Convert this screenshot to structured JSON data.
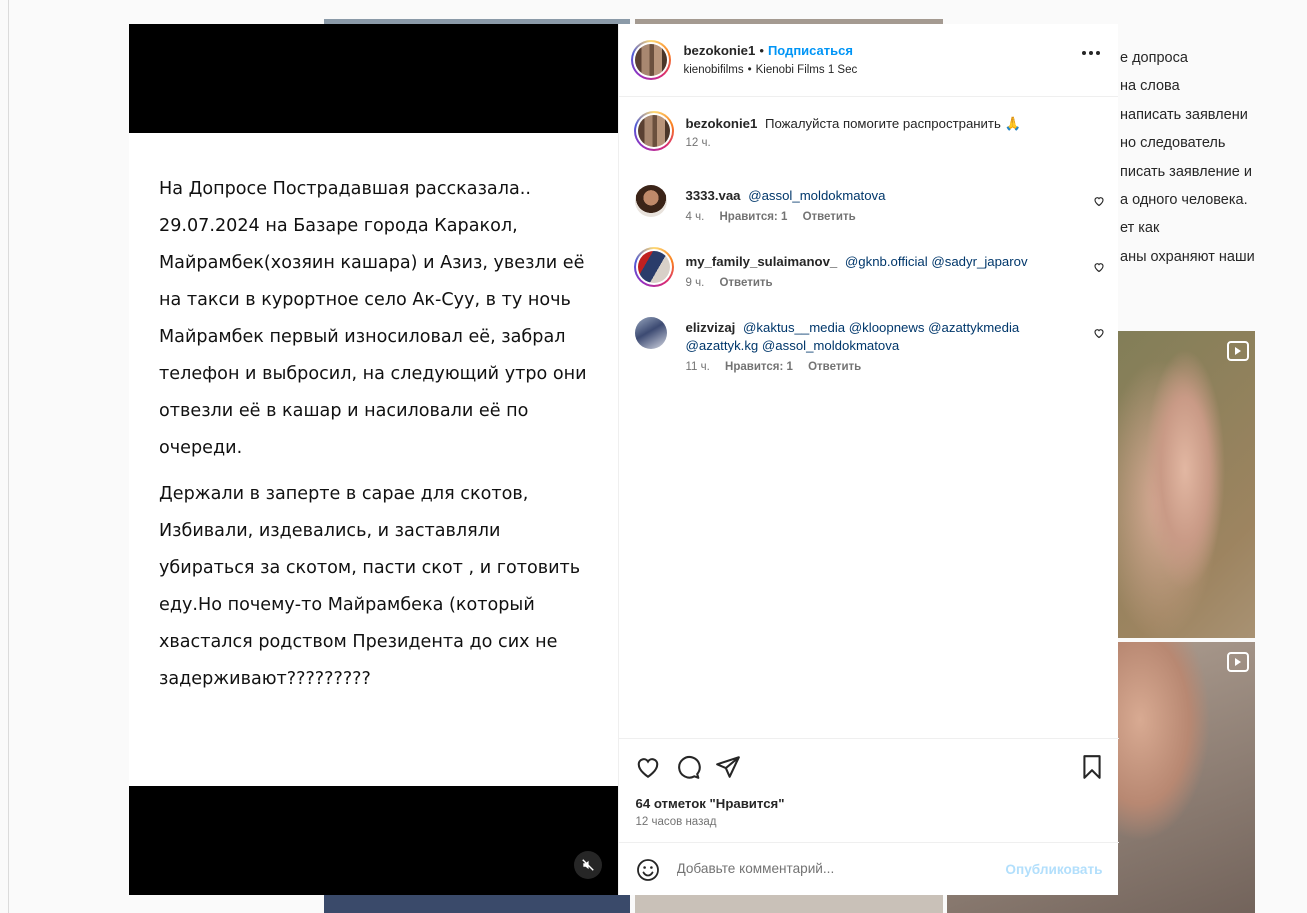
{
  "background": {
    "side_text": [
      "е допроса",
      "на слова",
      "написать заявлени",
      "но следователь",
      "писать заявление и",
      "а одного человека.",
      "ет как",
      "аны охраняют наши"
    ]
  },
  "post": {
    "username": "bezokonie1",
    "follow_label": "Подписаться",
    "audio_account": "kienobifilms",
    "audio_title": "Kienobi Films 1 Sec",
    "media_text": {
      "paragraph1": "На Допросе Пострадавшая рассказала.. 29.07.2024 на Базаре города Каракол, Майрамбек(хозяин кашара) и Азиз, увезли её на такси в курортное село Ак-Суу, в ту ночь Майрамбек первый износиловал её, забрал телефон и выбросил, на следующий утро они отвезли её в кашар и насиловали её по очереди.",
      "paragraph2": "Держали в заперте в сарае для скотов, Избивали, издевались, и заставляли убираться за скотом, пасти скот , и готовить еду.Но почему-то Майрамбека (который хвастался родством Президента до сих не задерживают?????????"
    },
    "caption": {
      "username": "bezokonie1",
      "text": "Пожалуйста помогите распространить 🙏",
      "time": "12 ч."
    },
    "comments": [
      {
        "username": "3333.vaa",
        "text": "@assol_moldokmatova",
        "time": "4 ч.",
        "likes": "Нравится: 1",
        "reply": "Ответить"
      },
      {
        "username": "my_family_sulaimanov_",
        "text": "@gknb.official @sadyr_japarov",
        "time": "9 ч.",
        "likes": "",
        "reply": "Ответить"
      },
      {
        "username": "elizvizaj",
        "text": "@kaktus__media @kloopnews @azattykmedia @azattyk.kg @assol_moldokmatova",
        "time": "11 ч.",
        "likes": "Нравится: 1",
        "reply": "Ответить"
      }
    ],
    "likes_count": "64 отметок \"Нравится\"",
    "time_ago": "12 часов назад",
    "comment_placeholder": "Добавьте комментарий...",
    "publish_label": "Опубликовать"
  }
}
